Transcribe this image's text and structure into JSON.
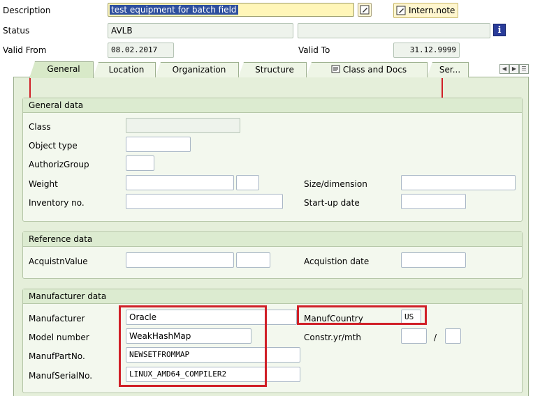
{
  "header": {
    "description_label": "Description",
    "description_value": "test equipment for batch field",
    "intern_note_label": "Intern.note",
    "status_label": "Status",
    "status_value": "AVLB",
    "valid_from_label": "Valid From",
    "valid_from_value": "08.02.2017",
    "valid_to_label": "Valid To",
    "valid_to_value": "31.12.9999",
    "info_glyph": "i"
  },
  "tabs": [
    {
      "label": "General"
    },
    {
      "label": "Location"
    },
    {
      "label": "Organization"
    },
    {
      "label": "Structure"
    },
    {
      "label": "Class and Docs"
    },
    {
      "label": "Ser..."
    }
  ],
  "general_data": {
    "title": "General data",
    "class_label": "Class",
    "object_type_label": "Object type",
    "authoriz_group_label": "AuthorizGroup",
    "weight_label": "Weight",
    "size_label": "Size/dimension",
    "inventory_label": "Inventory no.",
    "startup_label": "Start-up date"
  },
  "reference_data": {
    "title": "Reference data",
    "acq_value_label": "AcquistnValue",
    "acq_date_label": "Acquistion date"
  },
  "manufacturer_data": {
    "title": "Manufacturer data",
    "manufacturer_label": "Manufacturer",
    "manufacturer_value": "Oracle",
    "country_label": "ManufCountry",
    "country_value": "US",
    "model_label": "Model number",
    "model_value": "WeakHashMap",
    "constr_label": "Constr.yr/mth",
    "constr_sep": "/",
    "partno_label": "ManufPartNo.",
    "partno_value": "NEWSETFROMMAP",
    "serial_label": "ManufSerialNo.",
    "serial_value": "LINUX_AMD64_COMPILER2"
  },
  "colors": {
    "highlight_red": "#d01f27",
    "panel_green": "#e5efda",
    "selection_blue": "#2e4f9e"
  }
}
